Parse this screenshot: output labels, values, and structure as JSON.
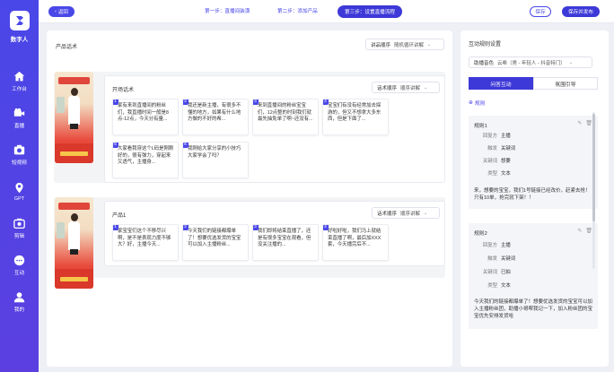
{
  "sidebar": {
    "brand": "数字人",
    "items": [
      {
        "label": "工作台",
        "icon": "home-icon"
      },
      {
        "label": "直播",
        "icon": "camera-icon"
      },
      {
        "label": "短视频",
        "icon": "video-icon"
      },
      {
        "label": "GPT",
        "icon": "location-icon"
      },
      {
        "label": "剪辑",
        "icon": "clip-icon"
      },
      {
        "label": "互动",
        "icon": "chat-icon"
      },
      {
        "label": "我的",
        "icon": "user-icon"
      }
    ]
  },
  "topbar": {
    "back": "返回",
    "steps": [
      "第一步：直播间装潢",
      "第二步：添加产品",
      "第三步：设置直播流程"
    ],
    "save": "保存",
    "publish": "保存并发布"
  },
  "main": {
    "title": "产品话术",
    "order_label": "讲品顺序",
    "order_value": "随机循环讲解",
    "products": [
      {
        "title": "开场话术",
        "order_label": "话术顺序",
        "order_value": "顺序讲解",
        "scripts": [
          {
            "n": "1",
            "text": "家有来到直播间的粉丝们，我直播时间一般是8点-12点，今天分有量..."
          },
          {
            "n": "2",
            "text": "我还是新主播，有很多不懂的地方，如果有什么地方做的不好的希..."
          },
          {
            "n": "3",
            "text": "来到直播间的粉丝宝宝们，12点整的时刻我们就最先抽免单了啊~还没有..."
          },
          {
            "n": "4",
            "text": "宝宝们有没有经常加去探游的，但又不想拿大多东西，但是下面了..."
          },
          {
            "n": "5",
            "text": "大家看我穿这个L码是刚刚好的，很有弹力，穿起来又透气，主播身..."
          },
          {
            "n": "6",
            "text": "我刚给大家分享的小技巧大家学会了吗？"
          }
        ]
      },
      {
        "title": "产品1",
        "order_label": "话术顺序",
        "order_value": "顺序讲解",
        "scripts": [
          {
            "n": "1",
            "text": "家宝宝们这个不移尽兴啊，是不是表现力度不够大？好，主播今天..."
          },
          {
            "n": "2",
            "text": "今天我们的链接都爆单了！想要优选发货的宝宝可以加入主播粉丝..."
          },
          {
            "n": "3",
            "text": "我们即将结束直播了，还是有很多宝宝在观看，但没关注播的..."
          },
          {
            "n": "4",
            "text": "好啦好啦，我们马上就结束直播了啊，最后加XXX套，今天播完后不..."
          }
        ]
      }
    ]
  },
  "right": {
    "title": "互动规则设置",
    "voice_label": "助播音色",
    "voice_value": "云希（男 - 年轻人 - 抖音特门）",
    "tabs": [
      "问答互动",
      "氛围引导"
    ],
    "add_rule": "规则",
    "rules": [
      {
        "name": "规则1",
        "fields": [
          {
            "k": "回复方",
            "v": "主播"
          },
          {
            "k": "触发",
            "v": "关键词"
          },
          {
            "k": "关键词",
            "v": "想要"
          },
          {
            "k": "类型",
            "v": "文本"
          }
        ],
        "reply": "来，想要的宝宝，我们1号链接已经改价，赶紧去抢！只有10单，抢完就下架！！"
      },
      {
        "name": "规则2",
        "fields": [
          {
            "k": "回复方",
            "v": "主播"
          },
          {
            "k": "触发",
            "v": "关键词"
          },
          {
            "k": "关键词",
            "v": "已拍"
          },
          {
            "k": "类型",
            "v": "文本"
          }
        ],
        "reply": "今天我们的链接都爆单了！想要优选发货的宝宝可以加入主播粉丝团，助播小哥帮我记一下，加入粉丝团的宝宝优先安排发货哈"
      }
    ]
  },
  "colors": {
    "accent": "#4a47e8",
    "sidebar": "#4a47e8"
  }
}
